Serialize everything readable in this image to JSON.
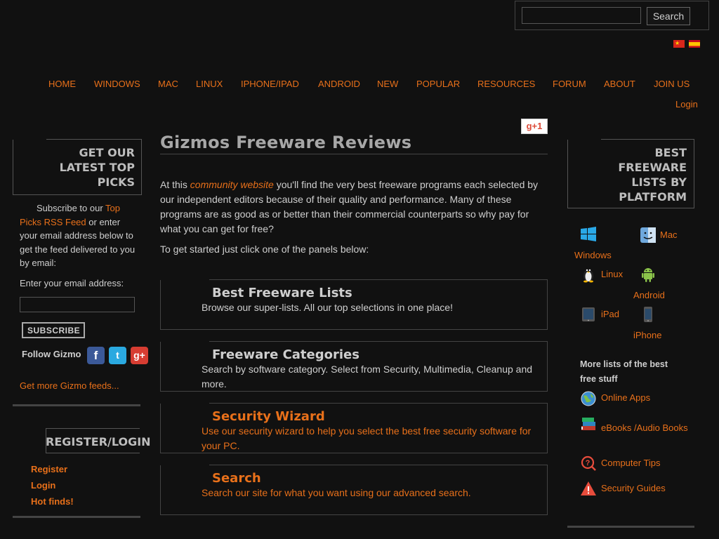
{
  "search": {
    "placeholder": "",
    "button_label": "Search"
  },
  "nav": {
    "items": [
      "HOME",
      "WINDOWS",
      "MAC",
      "LINUX",
      "IPHONE/IPAD",
      "ANDROID",
      "NEW",
      "POPULAR",
      "RESOURCES",
      "FORUM",
      "ABOUT",
      "JOIN US"
    ],
    "login_label": "Login"
  },
  "left": {
    "title_line1": "GET OUR",
    "title_line2": "LATEST TOP",
    "title_line3": "PICKS",
    "subscribe_prefix": "Subscribe to our ",
    "subscribe_link": "Top Picks RSS Feed",
    "subscribe_suffix": " or enter your email address below to get the feed delivered to you by email:",
    "email_label": "Enter your email address:",
    "subscribe_button": "SUBSCRIBE",
    "follow_label": "Follow Gizmo",
    "more_feeds": "Get more Gizmo feeds...",
    "register_title": "REGISTER/LOGIN",
    "links": [
      "Register",
      "Login",
      "Hot finds!"
    ]
  },
  "main": {
    "gplus_label": "g+1",
    "title": "Gizmos Freeware Reviews",
    "intro_prefix": "At this ",
    "intro_link": "community website",
    "intro_suffix": " you'll find the very best freeware programs each selected by our independent editors because of their quality and performance. Many of these programs are as good as or better than their commercial counterparts so why pay for what you can get for free?",
    "intro2": "To get started just click one of the panels below:",
    "panels": [
      {
        "title": "Best Freeware Lists",
        "desc": "Browse our super-lists. All our top selections in one place!"
      },
      {
        "title": "Freeware Categories",
        "desc": "Search by software category. Select from Security, Multimedia, Cleanup and more."
      },
      {
        "title": "Security Wizard",
        "desc": "Use our security wizard to help you select the best free security software for your PC."
      },
      {
        "title": "Search",
        "desc": "Search our site for what you want using our advanced search."
      }
    ]
  },
  "right": {
    "title_line1": "BEST",
    "title_line2": "FREEWARE",
    "title_line3": "LISTS BY",
    "title_line4": "PLATFORM",
    "platforms": [
      "Windows",
      "Mac",
      "Linux",
      "Android",
      "iPad",
      "iPhone"
    ],
    "more_lists": "More lists of the best free stuff",
    "resources": [
      "Online Apps",
      "eBooks /Audio Books",
      "Computer Tips",
      "Security Guides"
    ]
  },
  "colors": {
    "accent": "#e8701a",
    "background": "#111111",
    "text": "#cfcfcf",
    "heading": "#a7a7a7"
  }
}
